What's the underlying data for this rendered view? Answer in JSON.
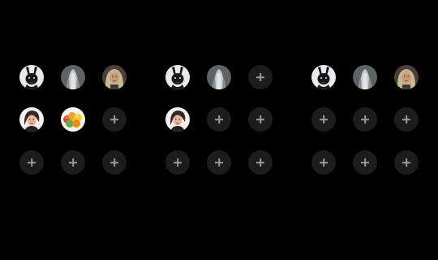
{
  "panels": [
    {
      "slots": [
        "bunny-mask-avatar",
        "ghost-avatar",
        "blonde-woman-avatar",
        "woman-portrait-avatar",
        "gummy-candy-avatar",
        "add",
        "add",
        "add",
        "add"
      ]
    },
    {
      "slots": [
        "bunny-mask-avatar",
        "ghost-avatar",
        "add",
        "woman-portrait-avatar",
        "add",
        "add",
        "add",
        "add",
        "add"
      ]
    },
    {
      "slots": [
        "bunny-mask-avatar",
        "ghost-avatar",
        "blonde-woman-avatar",
        "add",
        "add",
        "add",
        "add",
        "add",
        "add"
      ]
    }
  ],
  "colors": {
    "background": "#000000",
    "add_slot": "#1c1c1c",
    "plus": "#9a9a9a"
  }
}
